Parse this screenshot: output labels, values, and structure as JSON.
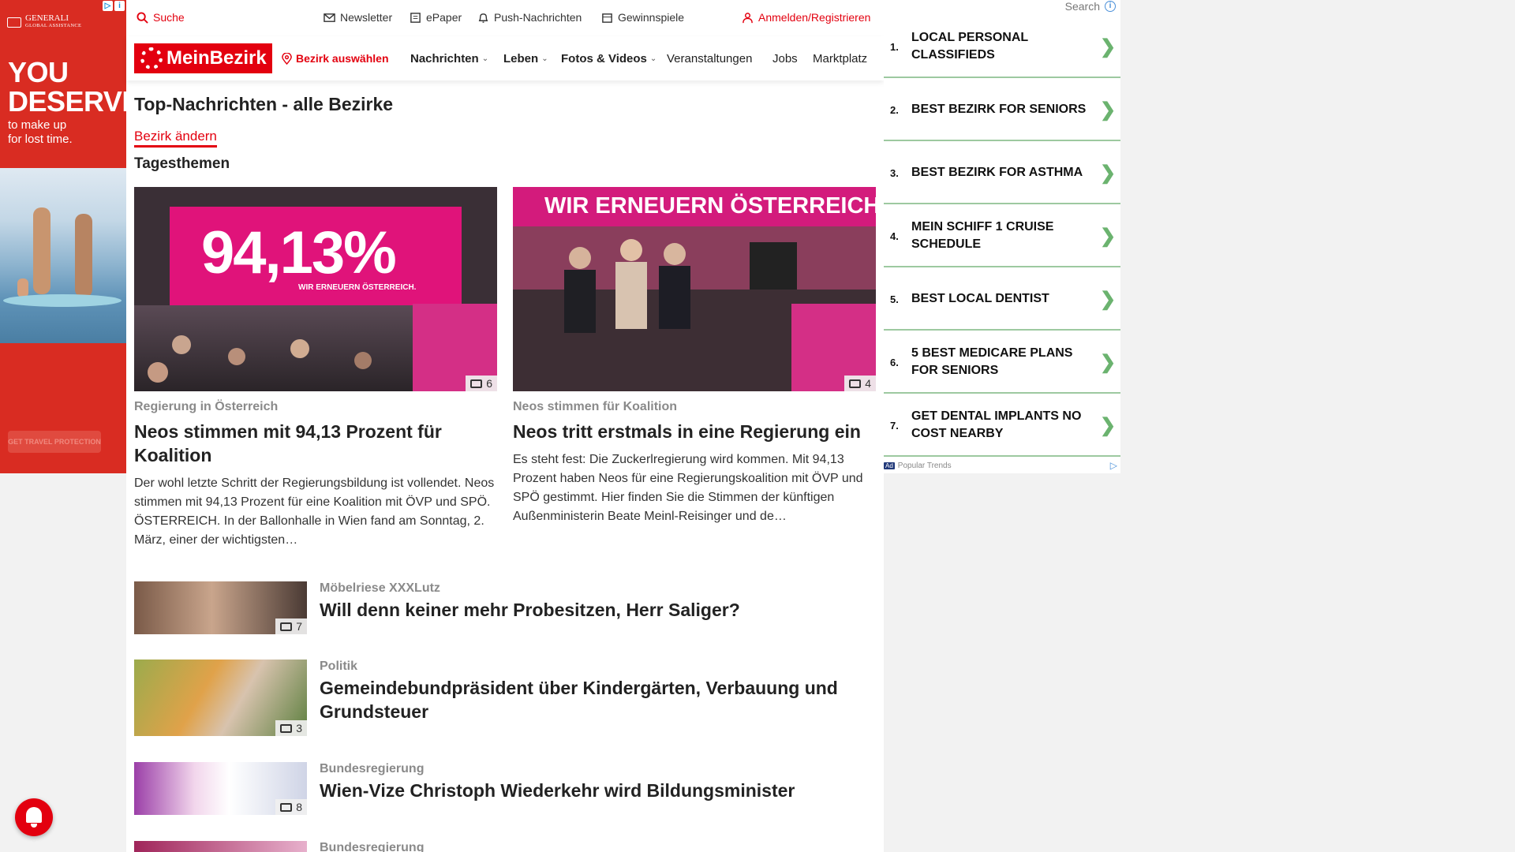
{
  "left_ad": {
    "brand": "GENERALI",
    "brand_sub": "GLOBAL ASSISTANCE",
    "headline_1": "YOU",
    "headline_2": "DESERVE",
    "sub_1": "to make up",
    "sub_2": "for lost time.",
    "cta": "GET TRAVEL PROTECTION"
  },
  "topbar": {
    "search": "Suche",
    "newsletter": "Newsletter",
    "epaper": "ePaper",
    "push": "Push-Nachrichten",
    "games": "Gewinnspiele",
    "login": "Anmelden/Registrieren"
  },
  "nav": {
    "brand": "MeinBezirk",
    "district": "Bezirk auswählen",
    "items": [
      "Nachrichten",
      "Leben",
      "Fotos & Videos",
      "Veranstaltungen",
      "Jobs",
      "Marktplatz"
    ]
  },
  "page": {
    "title": "Top-Nachrichten - alle Bezirke",
    "change_district": "Bezirk ändern",
    "section": "Tagesthemen"
  },
  "featured": [
    {
      "image_text": "94,13%",
      "image_sub": "WIR ERNEUERN ÖSTERREICH.",
      "photo_count": "6",
      "kicker": "Regierung in Österreich",
      "headline": "Neos stimmen mit 94,13 Prozent für Koalition",
      "teaser": "Der wohl letzte Schritt der Regierungsbildung ist vollendet. Neos stimmen mit 94,13 Prozent für eine Koalition mit ÖVP und SPÖ. ÖSTERREICH. In der Ballonhalle in Wien fand am Sonntag, 2. März, einer der wichtigsten…"
    },
    {
      "image_text": "WIR ERNEUERN ÖSTERREICH",
      "photo_count": "4",
      "kicker": "Neos stimmen für Koalition",
      "headline": "Neos tritt erstmals in eine Regierung ein",
      "teaser": "Es steht fest: Die Zuckerlregierung wird kommen. Mit 94,13 Prozent haben Neos für eine Regierungskoalition mit ÖVP und SPÖ gestimmt. Hier finden Sie die Stimmen der künftigen Außenministerin Beate Meinl-Reisinger und de…"
    }
  ],
  "list": [
    {
      "kicker": "Möbelriese XXXLutz",
      "headline": "Will denn keiner mehr Probesitzen, Herr Saliger?",
      "photo_count": "7"
    },
    {
      "kicker": "Politik",
      "headline": "Gemeindebundpräsident über Kindergärten, Verbauung und Grundsteuer",
      "photo_count": "3"
    },
    {
      "kicker": "Bundesregierung",
      "headline": "Wien-Vize Christoph Wiederkehr wird Bildungsminister",
      "photo_count": "8"
    },
    {
      "kicker": "Bundesregierung",
      "headline": "",
      "photo_count": ""
    }
  ],
  "right_ad": {
    "search_label": "Search",
    "items": [
      {
        "n": "1.",
        "t": "LOCAL PERSONAL CLASSIFIEDS"
      },
      {
        "n": "2.",
        "t": "BEST BEZIRK FOR SENIORS"
      },
      {
        "n": "3.",
        "t": "BEST BEZIRK FOR ASTHMA"
      },
      {
        "n": "4.",
        "t": "MEIN SCHIFF 1 CRUISE SCHEDULE"
      },
      {
        "n": "5.",
        "t": "BEST LOCAL DENTIST"
      },
      {
        "n": "6.",
        "t": "5 BEST MEDICARE PLANS FOR SENIORS"
      },
      {
        "n": "7.",
        "t": "GET DENTAL IMPLANTS NO COST NEARBY"
      }
    ],
    "ad_label": "Ad",
    "footer": "Popular Trends"
  },
  "colors": {
    "brand_red": "#e3000f",
    "ad_red": "#d92c22",
    "kicker_gray": "#8a8a8a",
    "ad_green": "#6bb36f"
  }
}
